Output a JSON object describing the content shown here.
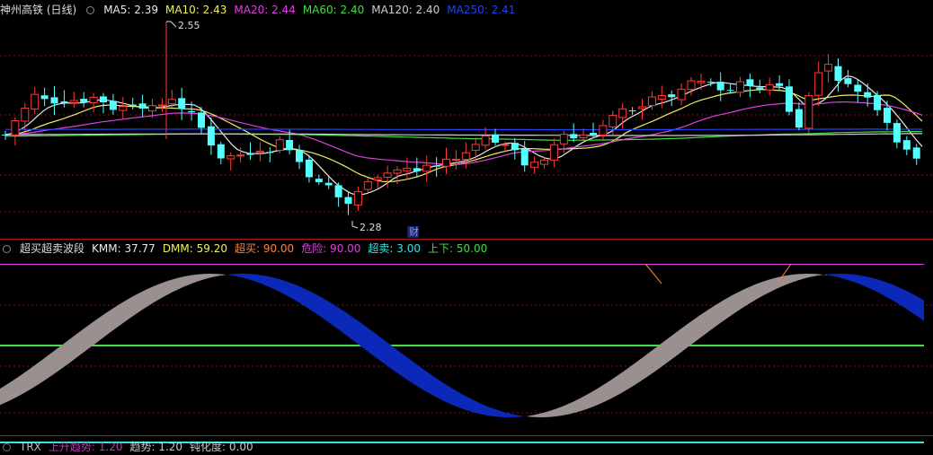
{
  "main_panel": {
    "symbol": "神州高铁 (日线)",
    "ma_legend": [
      {
        "label": "MA5: 2.39",
        "color": "#e8e8e8"
      },
      {
        "label": "MA10: 2.43",
        "color": "#f0f060"
      },
      {
        "label": "MA20: 2.44",
        "color": "#e040e0"
      },
      {
        "label": "MA60: 2.40",
        "color": "#40e040"
      },
      {
        "label": "MA120: 2.40",
        "color": "#d0d0d0"
      },
      {
        "label": "MA250: 2.41",
        "color": "#2040ff"
      }
    ],
    "high_label": "2.55",
    "low_label": "2.28",
    "finance_marker": "财"
  },
  "indicator_panel": {
    "name": "超买超卖波段",
    "legend": [
      {
        "label": "KMM: 37.77",
        "color": "#e8e8e8"
      },
      {
        "label": "DMM: 59.20",
        "color": "#f0f060"
      },
      {
        "label": "超买: 90.00",
        "color": "#ff8040"
      },
      {
        "label": "危险: 90.00",
        "color": "#e040e0"
      },
      {
        "label": "超卖: 3.00",
        "color": "#40e0e0"
      },
      {
        "label": "上下: 50.00",
        "color": "#40e040"
      }
    ]
  },
  "bottom_panel": {
    "name": "TRX",
    "legend": [
      {
        "label": "上升趋势: 1.20",
        "color": "#e040e0"
      },
      {
        "label": "趋势: 1.20",
        "color": "#e8e8e8"
      },
      {
        "label": "钝化度: 0.00",
        "color": "#e8e8e8"
      }
    ]
  },
  "colors": {
    "up_candle": "#ff3a3a",
    "down_candle": "#54ffff",
    "grid": "#8a1010",
    "divider": "#b01818",
    "kd_up_fill": "#9a9090",
    "kd_down_fill": "#0c28b8",
    "overbought_line": "#e040e0",
    "mid_line": "#40e040",
    "oversold_line": "#40e0e0"
  }
}
